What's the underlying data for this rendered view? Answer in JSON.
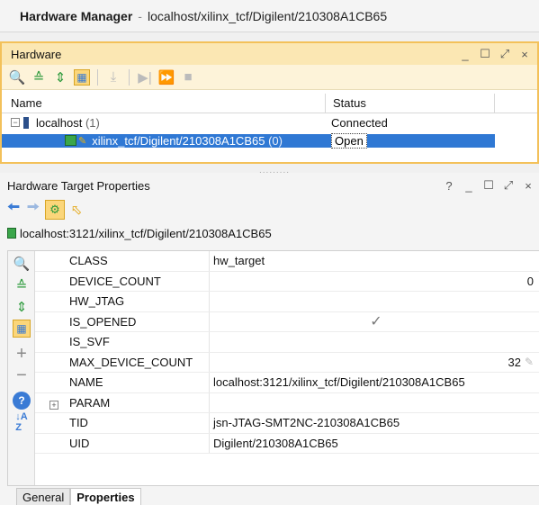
{
  "window": {
    "title_main": "Hardware Manager",
    "title_sep": "-",
    "title_path": "localhost/xilinx_tcf/Digilent/210308A1CB65"
  },
  "hardware": {
    "title": "Hardware",
    "controls": [
      "_",
      "☐",
      "⤢",
      "×"
    ],
    "columns": [
      "Name",
      "Status"
    ],
    "rows": [
      {
        "name": "localhost",
        "count": "(1)",
        "status": "Connected"
      },
      {
        "name": "xilinx_tcf/Digilent/210308A1CB65",
        "count": "(0)",
        "status": "Open"
      }
    ],
    "splitter": "........."
  },
  "props": {
    "title": "Hardware Target Properties",
    "controls": [
      "?",
      "_",
      "☐",
      "⤢",
      "×"
    ],
    "target": "localhost:3121/xilinx_tcf/Digilent/210308A1CB65",
    "rows": [
      {
        "key": "CLASS",
        "value": "hw_target"
      },
      {
        "key": "DEVICE_COUNT",
        "value": "0"
      },
      {
        "key": "HW_JTAG",
        "value": ""
      },
      {
        "key": "IS_OPENED",
        "value": "✓"
      },
      {
        "key": "IS_SVF",
        "value": ""
      },
      {
        "key": "MAX_DEVICE_COUNT",
        "value": "32"
      },
      {
        "key": "NAME",
        "value": "localhost:3121/xilinx_tcf/Digilent/210308A1CB65"
      },
      {
        "key": "PARAM",
        "value": ""
      },
      {
        "key": "TID",
        "value": "jsn-JTAG-SMT2NC-210308A1CB65"
      },
      {
        "key": "UID",
        "value": "Digilent/210308A1CB65"
      }
    ],
    "tabs": [
      "General",
      "Properties"
    ]
  },
  "colors": {
    "panel_border": "#f3c15a",
    "panel_header": "#fbe7b3",
    "selection": "#2f78d4"
  }
}
